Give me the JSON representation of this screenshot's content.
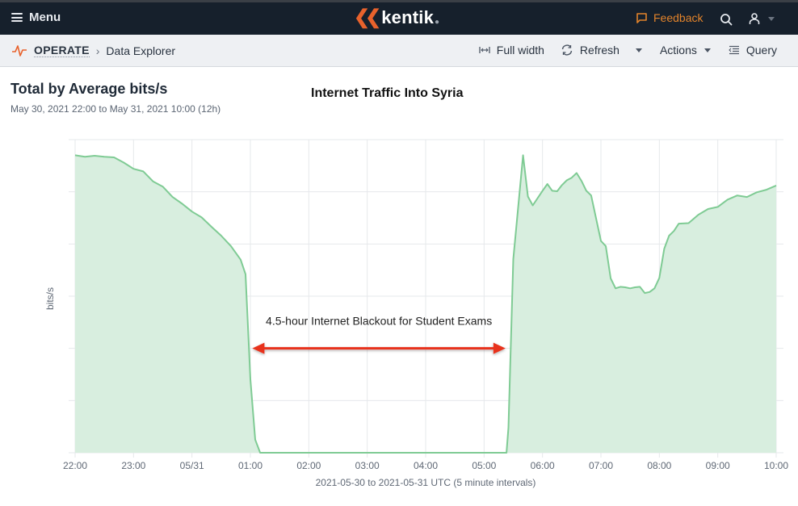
{
  "topbar": {
    "menu_label": "Menu",
    "logo_text": "kentik",
    "feedback_label": "Feedback",
    "colors": {
      "background": "#16202c",
      "brand": "#e8622c",
      "feedback": "#e2832b"
    }
  },
  "subbar": {
    "breadcrumb": {
      "section": "OPERATE",
      "page": "Data Explorer"
    },
    "tools": {
      "full_width": "Full width",
      "refresh": "Refresh",
      "actions": "Actions",
      "query": "Query"
    }
  },
  "panel": {
    "title": "Total by Average bits/s",
    "subtitle": "May 30, 2021 22:00 to May 31, 2021 10:00 (12h)"
  },
  "chart_data": {
    "type": "area",
    "title": "Internet Traffic Into Syria",
    "xlabel": "2021-05-30 to 2021-05-31 UTC (5 minute intervals)",
    "ylabel": "bits/s",
    "y_units_note": "relative (no y tick labels shown); 1 unit = 1 gridline",
    "ylim": [
      0,
      6
    ],
    "xlim_minutes_from_start": [
      0,
      720
    ],
    "grid": true,
    "legend": "none",
    "x_tick_labels": [
      "22:00",
      "23:00",
      "05/31",
      "01:00",
      "02:00",
      "03:00",
      "04:00",
      "05:00",
      "06:00",
      "07:00",
      "08:00",
      "09:00",
      "10:00"
    ],
    "series": [
      {
        "name": "Total",
        "color": "#7fcb94",
        "fill": "#d8eedf",
        "points": [
          [
            0,
            5.7
          ],
          [
            10,
            5.67
          ],
          [
            20,
            5.69
          ],
          [
            30,
            5.67
          ],
          [
            40,
            5.66
          ],
          [
            50,
            5.56
          ],
          [
            60,
            5.44
          ],
          [
            70,
            5.39
          ],
          [
            80,
            5.2
          ],
          [
            90,
            5.1
          ],
          [
            100,
            4.9
          ],
          [
            110,
            4.77
          ],
          [
            120,
            4.62
          ],
          [
            130,
            4.51
          ],
          [
            140,
            4.33
          ],
          [
            150,
            4.16
          ],
          [
            160,
            3.96
          ],
          [
            170,
            3.7
          ],
          [
            175,
            3.42
          ],
          [
            180,
            1.41
          ],
          [
            185,
            0.25
          ],
          [
            190,
            0.0
          ],
          [
            200,
            0.0
          ],
          [
            260,
            0.0
          ],
          [
            320,
            0.0
          ],
          [
            380,
            0.0
          ],
          [
            440,
            0.0
          ],
          [
            443,
            0.0
          ],
          [
            445,
            0.48
          ],
          [
            450,
            3.71
          ],
          [
            460,
            5.7
          ],
          [
            465,
            4.91
          ],
          [
            470,
            4.74
          ],
          [
            480,
            5.02
          ],
          [
            485,
            5.15
          ],
          [
            490,
            5.02
          ],
          [
            495,
            5.01
          ],
          [
            500,
            5.13
          ],
          [
            505,
            5.22
          ],
          [
            510,
            5.27
          ],
          [
            515,
            5.36
          ],
          [
            520,
            5.21
          ],
          [
            525,
            5.02
          ],
          [
            530,
            4.93
          ],
          [
            540,
            4.06
          ],
          [
            545,
            3.96
          ],
          [
            550,
            3.34
          ],
          [
            555,
            3.15
          ],
          [
            560,
            3.18
          ],
          [
            565,
            3.17
          ],
          [
            570,
            3.15
          ],
          [
            575,
            3.17
          ],
          [
            580,
            3.18
          ],
          [
            585,
            3.06
          ],
          [
            590,
            3.08
          ],
          [
            595,
            3.15
          ],
          [
            600,
            3.35
          ],
          [
            605,
            3.91
          ],
          [
            610,
            4.16
          ],
          [
            615,
            4.25
          ],
          [
            620,
            4.39
          ],
          [
            630,
            4.4
          ],
          [
            640,
            4.56
          ],
          [
            650,
            4.67
          ],
          [
            660,
            4.71
          ],
          [
            670,
            4.85
          ],
          [
            680,
            4.93
          ],
          [
            690,
            4.9
          ],
          [
            700,
            4.99
          ],
          [
            710,
            5.04
          ],
          [
            720,
            5.12
          ]
        ]
      }
    ],
    "annotations": [
      {
        "text": "4.5-hour Internet Blackout for Student Exams",
        "arrow": {
          "type": "double",
          "from_minutes": 182,
          "to_minutes": 442,
          "y": 2.0,
          "color": "#e8321e"
        }
      }
    ]
  }
}
